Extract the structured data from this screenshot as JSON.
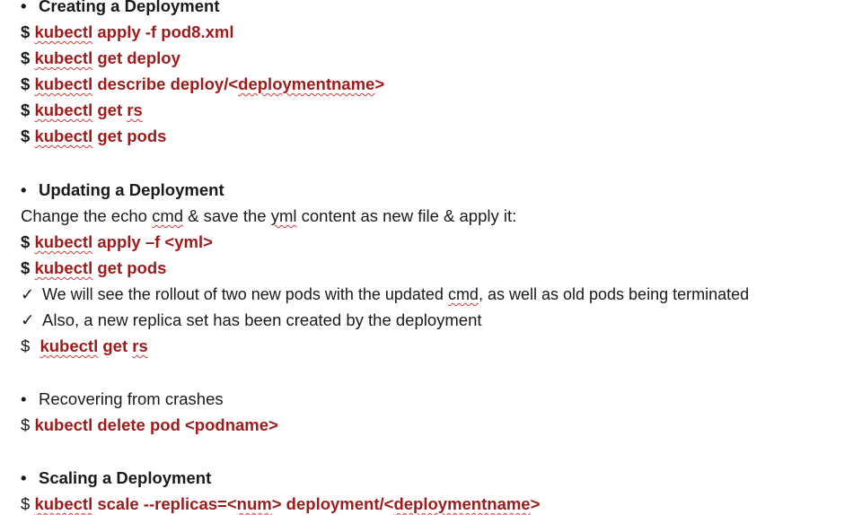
{
  "sections": {
    "creating": {
      "bullet": "•",
      "title": "Creating a Deployment",
      "cmds": [
        {
          "prefix": "$",
          "tool": "kubectl",
          "rest1": " apply -f pod8.xml"
        },
        {
          "prefix": "$",
          "tool": "kubectl",
          "rest1": " get deploy"
        },
        {
          "prefix": "$",
          "tool": "kubectl",
          "rest1": " describe deploy/<",
          "sq": "deploymentname",
          "rest2": ">"
        },
        {
          "prefix": "$",
          "tool": "kubectl",
          "rest1": " get ",
          "sq": "rs"
        },
        {
          "prefix": "$",
          "tool": "kubectl",
          "rest1": " get pods"
        }
      ]
    },
    "updating": {
      "bullet": "•",
      "title": "Updating a Deployment",
      "desc": {
        "p1": "Change the echo ",
        "w1": "cmd",
        "p2": " & save the ",
        "w2": "yml",
        "p3": " content as new file & apply it:"
      },
      "cmds": [
        {
          "prefix": "$",
          "tool": "kubectl",
          "rest1": " apply –f <yml>"
        },
        {
          "prefix": "$",
          "tool": "kubectl",
          "rest1": " get pods"
        }
      ],
      "check1": {
        "mark": "✓",
        "p1": "We will see the rollout of two new pods with the updated ",
        "w": "cmd",
        "p2": ", as well as old pods being terminated"
      },
      "check2": {
        "mark": "✓",
        "text": "Also, a new replica set has been created by the deployment"
      },
      "cmd3": {
        "prefix": "$",
        "tool": "kubectl",
        "rest1": " get ",
        "sq": "rs"
      }
    },
    "recovering": {
      "bullet": "•",
      "title": "Recovering from crashes",
      "cmd": {
        "prefix": "$",
        "tool": "kubectl",
        "rest1": " delete pod <podname>"
      }
    },
    "scaling": {
      "bullet": "•",
      "title": "Scaling a Deployment",
      "cmd": {
        "prefix": "$",
        "tool": "kubectl",
        "rest1": " scale --replicas=<",
        "sq": "num",
        "rest2": "> deployment/<",
        "sq2": "deploymentname",
        "rest3": ">"
      }
    }
  },
  "colors": {
    "command": "#9e1b1b",
    "text": "#1a1a1a",
    "spellcheck": "#d23a3a"
  }
}
